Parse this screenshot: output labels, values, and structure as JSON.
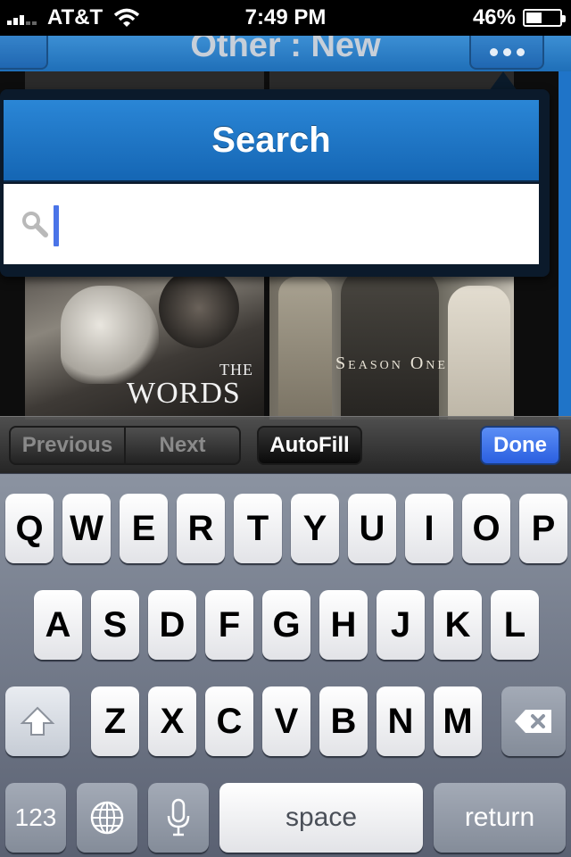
{
  "status_bar": {
    "carrier": "AT&T",
    "time": "7:49 PM",
    "battery": "46%",
    "battery_level": 0.46
  },
  "nav": {
    "title": "Other : New"
  },
  "posters": {
    "words_small": "THE",
    "words_big": "WORDS",
    "season_title": "Season One"
  },
  "search": {
    "title": "Search",
    "input_value": "",
    "placeholder": ""
  },
  "toolbar": {
    "previous_label": "Previous",
    "next_label": "Next",
    "autofill_label": "AutoFill",
    "done_label": "Done"
  },
  "keyboard": {
    "row1": [
      "Q",
      "W",
      "E",
      "R",
      "T",
      "Y",
      "U",
      "I",
      "O",
      "P"
    ],
    "row2": [
      "A",
      "S",
      "D",
      "F",
      "G",
      "H",
      "J",
      "K",
      "L"
    ],
    "row3": [
      "Z",
      "X",
      "C",
      "V",
      "B",
      "N",
      "M"
    ],
    "numbers_label": "123",
    "space_label": "space",
    "return_label": "return"
  },
  "colors": {
    "accent_blue": "#1f74c8",
    "done_blue": "#2a5fe0",
    "cursor_blue": "#4a74e8"
  },
  "icons": [
    "wifi-icon",
    "battery-icon",
    "more-icon",
    "search-icon",
    "shift-icon",
    "delete-icon",
    "globe-icon",
    "microphone-icon"
  ]
}
